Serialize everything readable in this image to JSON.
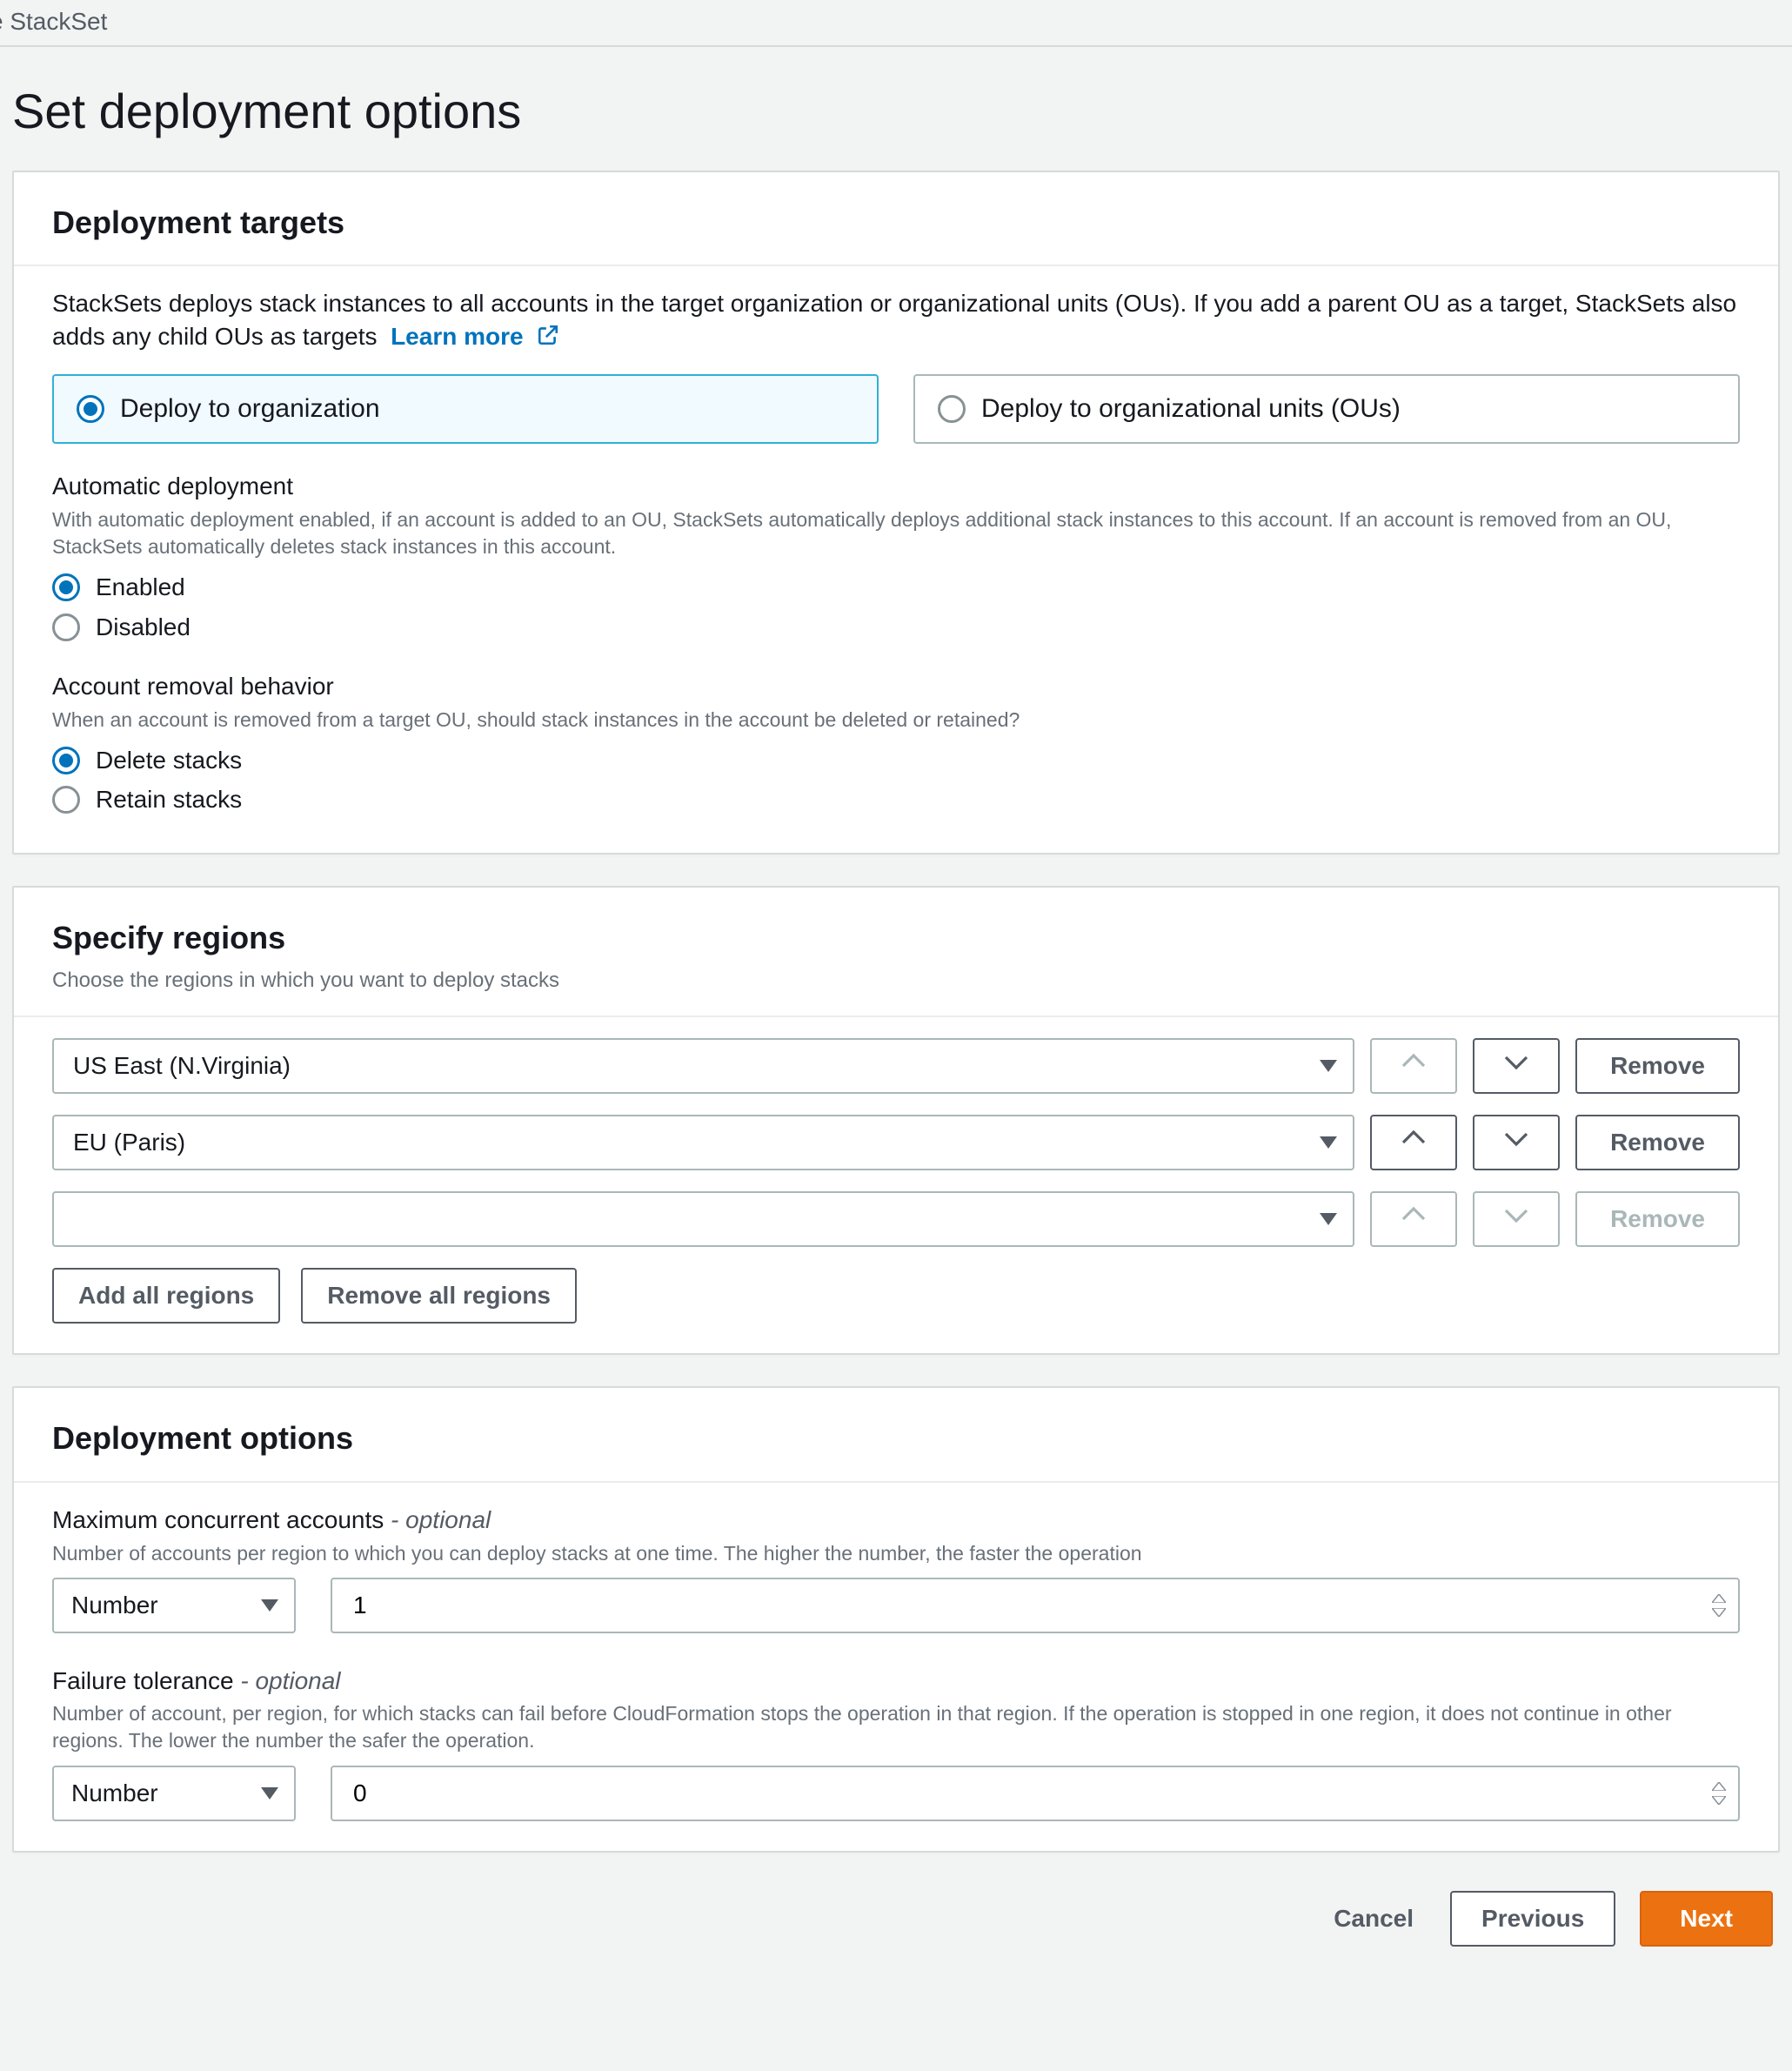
{
  "breadcrumb": "e StackSet",
  "page_title": "Set deployment options",
  "targets": {
    "heading": "Deployment targets",
    "desc": "StackSets deploys stack instances to all accounts in the target organization or organizational units (OUs). If you add a parent OU as a target, StackSets also adds any child OUs as targets",
    "learn_more": "Learn more",
    "tiles": {
      "org": "Deploy to organization",
      "ous": "Deploy to organizational units (OUs)"
    },
    "auto": {
      "label": "Automatic deployment",
      "help": "With automatic deployment enabled, if an account is added to an OU, StackSets automatically deploys additional stack instances to this account. If an account is removed from an OU, StackSets automatically deletes stack instances in this account.",
      "opt_enabled": "Enabled",
      "opt_disabled": "Disabled"
    },
    "removal": {
      "label": "Account removal behavior",
      "help": "When an account is removed from a target OU, should stack instances in the account be deleted or retained?",
      "opt_delete": "Delete stacks",
      "opt_retain": "Retain stacks"
    }
  },
  "regions": {
    "heading": "Specify regions",
    "sub": "Choose the regions in which you want to deploy stacks",
    "rows": [
      {
        "value": "US East (N.Virginia)",
        "up_enabled": false,
        "down_enabled": true,
        "remove_enabled": true
      },
      {
        "value": "EU (Paris)",
        "up_enabled": true,
        "down_enabled": true,
        "remove_enabled": true
      },
      {
        "value": "",
        "up_enabled": false,
        "down_enabled": false,
        "remove_enabled": false
      }
    ],
    "remove_label": "Remove",
    "add_all": "Add all regions",
    "remove_all": "Remove all regions"
  },
  "deploy_opts": {
    "heading": "Deployment options",
    "max": {
      "label_main": "Maximum concurrent accounts",
      "label_suffix": " - optional",
      "help": "Number of accounts per region to which you can deploy stacks at one time. The higher the number, the faster the operation",
      "selector": "Number",
      "value": "1"
    },
    "fail": {
      "label_main": "Failure tolerance",
      "label_suffix": " - optional",
      "help": "Number of account, per region, for which stacks can fail before CloudFormation stops the operation in that region. If the operation is stopped in one region, it does not continue in other regions. The lower the number the safer the operation.",
      "selector": "Number",
      "value": "0"
    }
  },
  "footer": {
    "cancel": "Cancel",
    "previous": "Previous",
    "next": "Next"
  }
}
